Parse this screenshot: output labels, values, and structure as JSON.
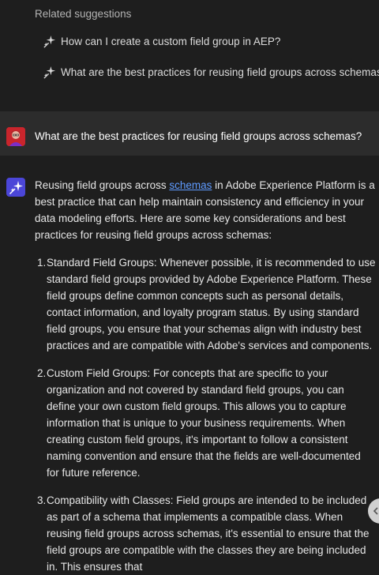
{
  "related": {
    "title": "Related suggestions",
    "items": [
      {
        "label": "How can I create a custom field group in AEP?",
        "icon": "sparkle-icon"
      },
      {
        "label": "What are the best practices for reusing field groups across schemas?",
        "icon": "sparkle-icon"
      }
    ]
  },
  "user_message": {
    "avatar": "user-avatar",
    "text": "What are the best practices for reusing field groups across schemas?"
  },
  "assistant": {
    "avatar": "ai-assistant-icon",
    "intro_before_link": "Reusing field groups across ",
    "intro_link": "schemas",
    "intro_after_link": " in Adobe Experience Platform is a best practice that can help maintain consistency and efficiency in your data modeling efforts. Here are some key considerations and best practices for reusing field groups across schemas:",
    "items": [
      {
        "number": "1.",
        "text": "Standard Field Groups: Whenever possible, it is recommended to use standard field groups provided by Adobe Experience Platform. These field groups define common concepts such as personal details, contact information, and loyalty program status. By using standard field groups, you ensure that your schemas align with industry best practices and are compatible with Adobe's services and components."
      },
      {
        "number": "2.",
        "text": "Custom Field Groups: For concepts that are specific to your organization and not covered by standard field groups, you can define your own custom field groups. This allows you to capture information that is unique to your business requirements. When creating custom field groups, it's important to follow a consistent naming convention and ensure that the fields are well-documented for future reference."
      },
      {
        "number": "3.",
        "text": "Compatibility with Classes: Field groups are intended to be included as part of a schema that implements a compatible class. When reusing field groups across schemas, it's essential to ensure that the field groups are compatible with the classes they are being included in. This ensures that"
      }
    ]
  },
  "colors": {
    "background": "#1e1e1e",
    "user_row": "#2c2c2c",
    "link": "#5f9bff",
    "user_avatar": "#c9252c",
    "assistant_avatar": "#4b46d8"
  }
}
